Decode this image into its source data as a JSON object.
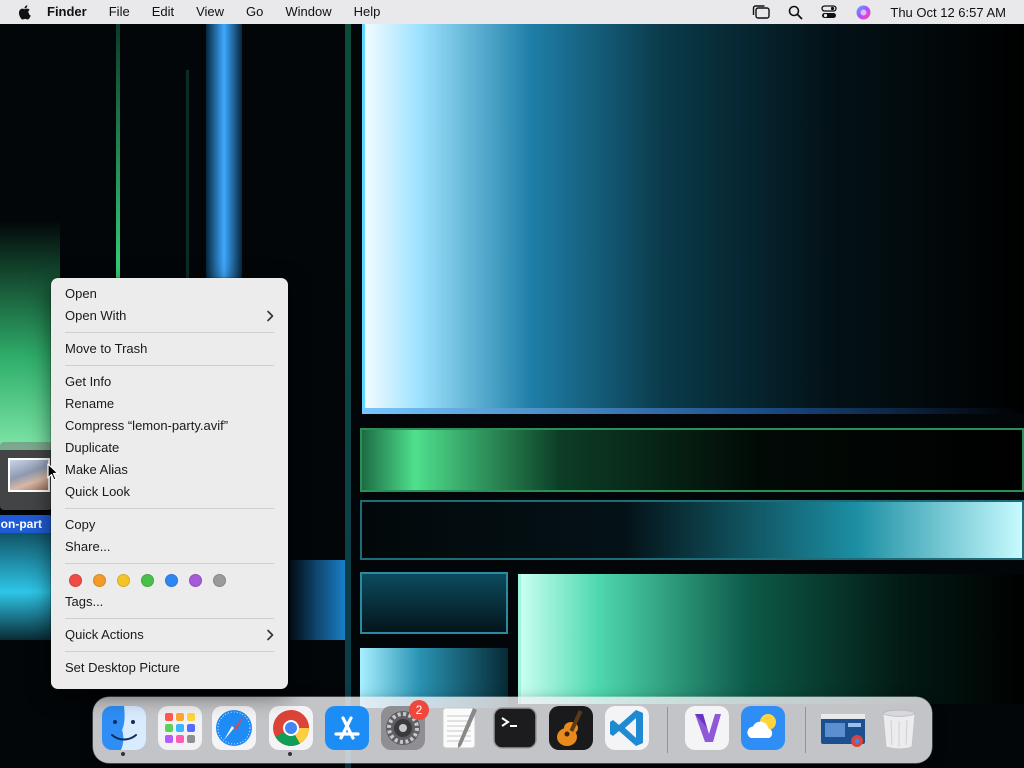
{
  "menubar": {
    "app_name": "Finder",
    "menus": [
      "File",
      "Edit",
      "View",
      "Go",
      "Window",
      "Help"
    ],
    "clock": "Thu Oct 12  6:57 AM",
    "status_icons": [
      "stage-manager-icon",
      "spotlight-search-icon",
      "control-center-icon",
      "siri-icon"
    ]
  },
  "desktop": {
    "selected_file_label": "mon-part"
  },
  "context_menu": {
    "groups": [
      [
        {
          "label": "Open",
          "submenu": false
        },
        {
          "label": "Open With",
          "submenu": true
        }
      ],
      [
        {
          "label": "Move to Trash",
          "submenu": false
        }
      ],
      [
        {
          "label": "Get Info",
          "submenu": false
        },
        {
          "label": "Rename",
          "submenu": false
        },
        {
          "label": "Compress “lemon-party.avif”",
          "submenu": false
        },
        {
          "label": "Duplicate",
          "submenu": false
        },
        {
          "label": "Make Alias",
          "submenu": false
        },
        {
          "label": "Quick Look",
          "submenu": false
        }
      ],
      [
        {
          "label": "Copy",
          "submenu": false
        },
        {
          "label": "Share...",
          "submenu": false
        }
      ],
      [
        {
          "label": "Tags...",
          "submenu": false
        }
      ],
      [
        {
          "label": "Quick Actions",
          "submenu": true
        }
      ],
      [
        {
          "label": "Set Desktop Picture",
          "submenu": false
        }
      ]
    ],
    "tag_colors": [
      {
        "name": "red",
        "color": "#ee4c45"
      },
      {
        "name": "orange",
        "color": "#f39a2b"
      },
      {
        "name": "yellow",
        "color": "#f4c427"
      },
      {
        "name": "green",
        "color": "#49bf4b"
      },
      {
        "name": "blue",
        "color": "#2f86f1"
      },
      {
        "name": "purple",
        "color": "#a55ad8"
      },
      {
        "name": "gray",
        "color": "#9a9a9a"
      }
    ]
  },
  "dock": {
    "apps": [
      {
        "name": "Finder",
        "icon": "finder-icon",
        "running": true
      },
      {
        "name": "Launchpad",
        "icon": "launchpad-icon",
        "running": false
      },
      {
        "name": "Safari",
        "icon": "safari-icon",
        "running": false
      },
      {
        "name": "Google Chrome",
        "icon": "chrome-icon",
        "running": true
      },
      {
        "name": "App Store",
        "icon": "app-store-icon",
        "running": false
      },
      {
        "name": "System Settings",
        "icon": "system-settings-icon",
        "running": false,
        "badge": "2"
      },
      {
        "name": "TextEdit",
        "icon": "textedit-icon",
        "running": false
      },
      {
        "name": "Terminal",
        "icon": "terminal-icon",
        "running": false
      },
      {
        "name": "GarageBand",
        "icon": "garageband-icon",
        "running": false
      },
      {
        "name": "Visual Studio Code",
        "icon": "vscode-icon",
        "running": false
      },
      {
        "name": "Visual Studio",
        "icon": "visual-studio-icon",
        "running": false
      },
      {
        "name": "Weather",
        "icon": "weather-icon",
        "running": false
      },
      {
        "name": "Chrome Window",
        "icon": "chrome-window-thumbnail-icon",
        "running": false
      },
      {
        "name": "Trash",
        "icon": "trash-icon",
        "running": false
      }
    ]
  },
  "colors": {
    "selection_blue": "#1f5bd6",
    "menu_bg": "#ececec",
    "badge_red": "#f0463c"
  }
}
